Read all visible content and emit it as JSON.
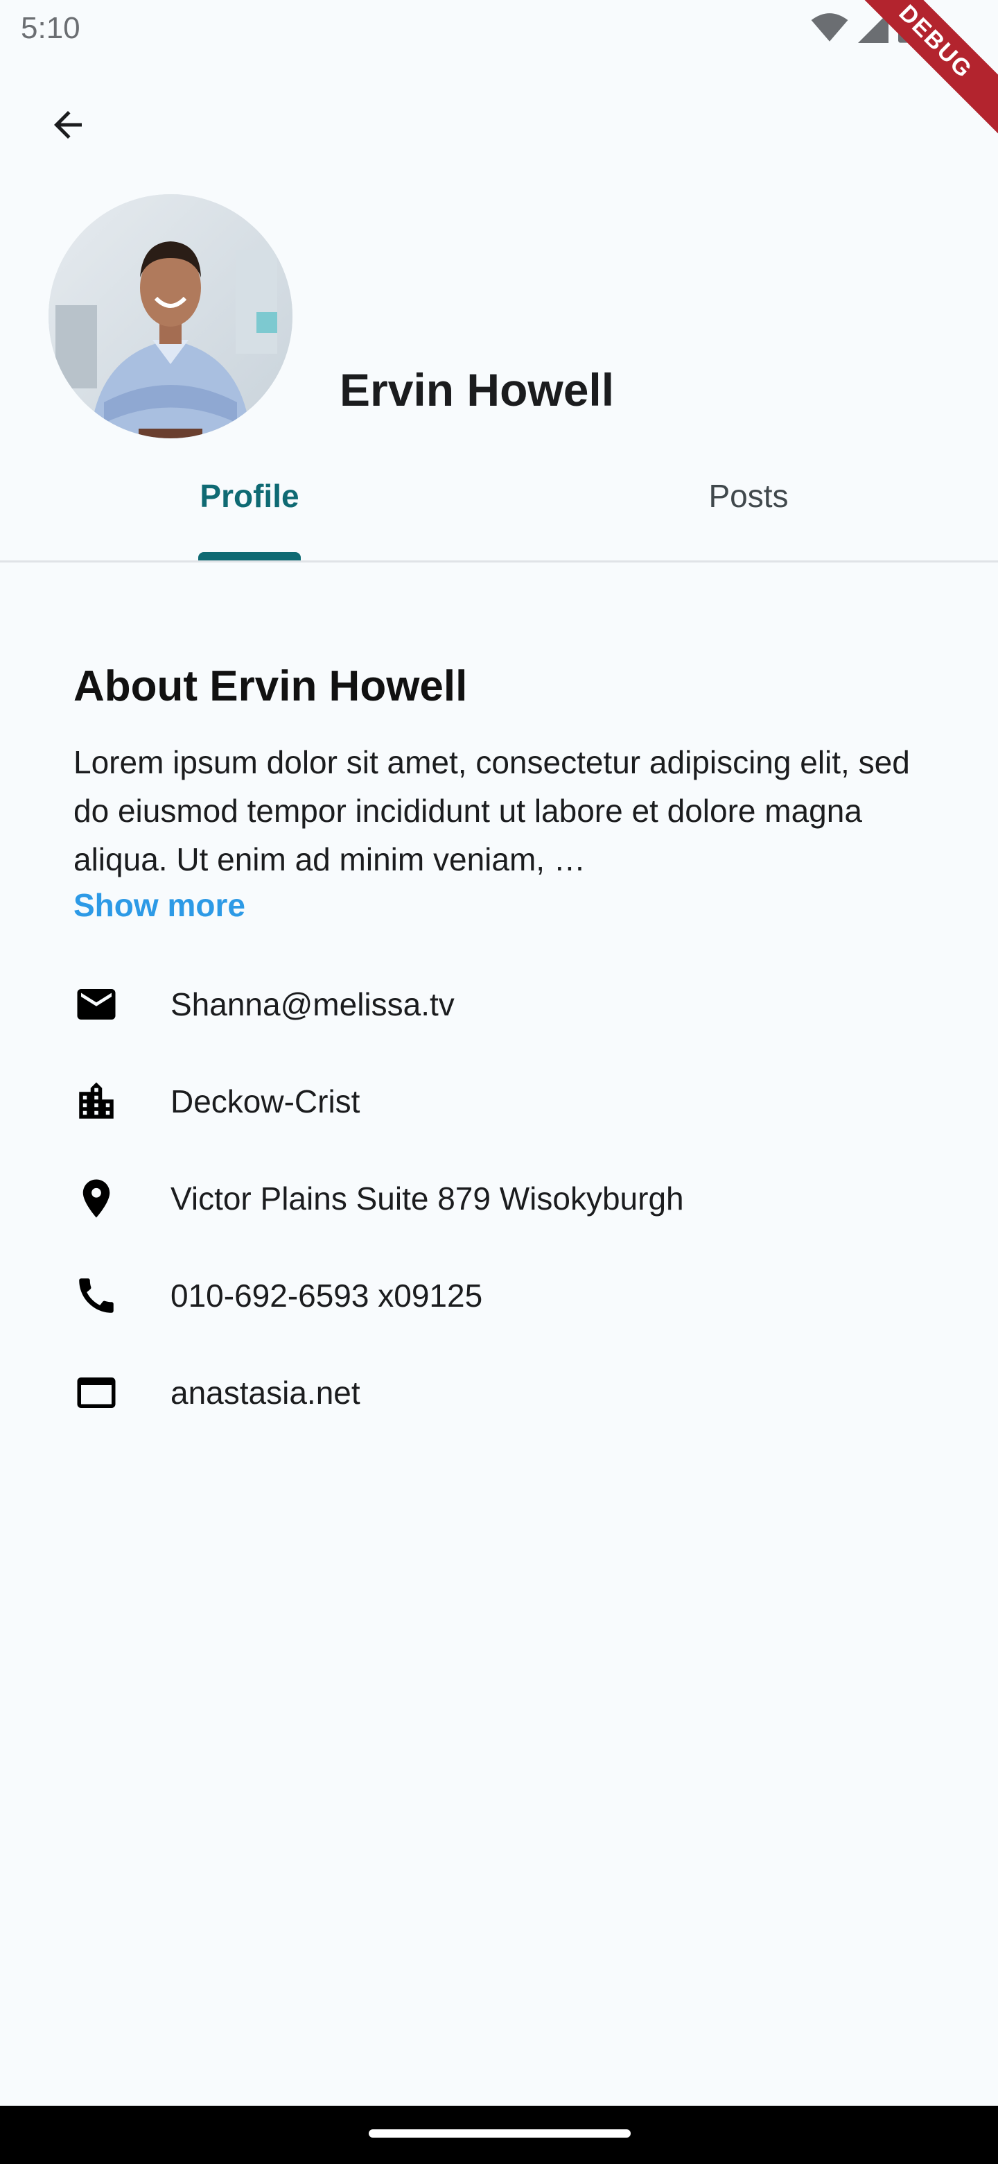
{
  "status_bar": {
    "time": "5:10",
    "debug_label": "DEBUG",
    "icons": [
      "wifi-icon",
      "signal-icon",
      "battery-icon"
    ]
  },
  "header": {
    "back_icon": "arrow-back-icon",
    "name": "Ervin Howell",
    "avatar": "avatar-photo"
  },
  "tabs": [
    {
      "label": "Profile",
      "selected": true
    },
    {
      "label": "Posts",
      "selected": false
    }
  ],
  "about": {
    "title": "About Ervin Howell",
    "text": "Lorem ipsum dolor sit amet, consectetur adipiscing elit, sed do eiusmod tempor incididunt ut labore et dolore magna aliqua. Ut enim ad minim veniam, …",
    "show_more": "Show more"
  },
  "contact": [
    {
      "icon": "email-icon",
      "value": "Shanna@melissa.tv"
    },
    {
      "icon": "company-icon",
      "value": "Deckow-Crist"
    },
    {
      "icon": "location-icon",
      "value": "Victor Plains Suite 879 Wisokyburgh"
    },
    {
      "icon": "phone-icon",
      "value": "010-692-6593 x09125"
    },
    {
      "icon": "website-icon",
      "value": "anastasia.net"
    }
  ],
  "colors": {
    "background": "#f8fbfd",
    "accent": "#0f6a73",
    "link": "#2d9ae6",
    "debug": "#b3242e"
  }
}
